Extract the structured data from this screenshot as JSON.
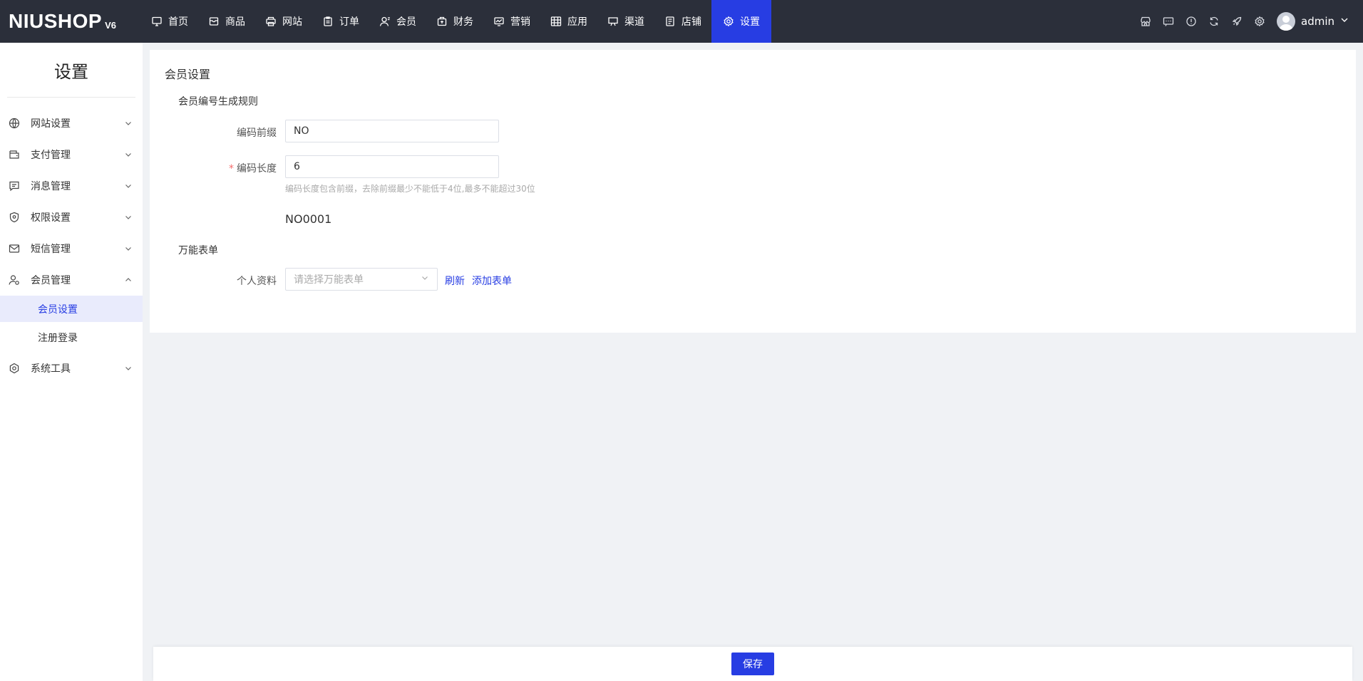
{
  "brand": {
    "name": "NIUSHOP",
    "version": "V6"
  },
  "topnav": {
    "items": [
      {
        "label": "首页",
        "icon": "monitor-icon"
      },
      {
        "label": "商品",
        "icon": "box-icon"
      },
      {
        "label": "网站",
        "icon": "printer-icon"
      },
      {
        "label": "订单",
        "icon": "clipboard-icon"
      },
      {
        "label": "会员",
        "icon": "user-icon"
      },
      {
        "label": "财务",
        "icon": "wallet-icon"
      },
      {
        "label": "营销",
        "icon": "chart-icon"
      },
      {
        "label": "应用",
        "icon": "grid-icon"
      },
      {
        "label": "渠道",
        "icon": "display-icon"
      },
      {
        "label": "店铺",
        "icon": "document-icon"
      },
      {
        "label": "设置",
        "icon": "gear-icon",
        "active": true
      }
    ],
    "active_color": "#273de3"
  },
  "user": {
    "name": "admin"
  },
  "sidebar": {
    "title": "设置",
    "items": [
      {
        "label": "网站设置",
        "icon": "globe-icon"
      },
      {
        "label": "支付管理",
        "icon": "wallet-icon"
      },
      {
        "label": "消息管理",
        "icon": "message-icon"
      },
      {
        "label": "权限设置",
        "icon": "shield-icon"
      },
      {
        "label": "短信管理",
        "icon": "mail-icon"
      },
      {
        "label": "会员管理",
        "icon": "user-settings-icon",
        "expanded": true
      },
      {
        "label": "系统工具",
        "icon": "tool-icon"
      }
    ],
    "sub_items": [
      {
        "label": "会员设置",
        "active": true
      },
      {
        "label": "注册登录"
      }
    ]
  },
  "main": {
    "title": "会员设置",
    "code_rule": {
      "section_title": "会员编号生成规则",
      "prefix_label": "编码前缀",
      "prefix_value": "NO",
      "length_label": "编码长度",
      "length_value": "6",
      "length_hint": "编码长度包含前缀，去除前缀最少不能低于4位,最多不能超过30位",
      "preview": "NO0001"
    },
    "form_section": {
      "section_title": "万能表单",
      "profile_label": "个人资料",
      "select_placeholder": "请选择万能表单",
      "refresh_link": "刷新",
      "add_link": "添加表单"
    }
  },
  "footer": {
    "save_label": "保存"
  }
}
